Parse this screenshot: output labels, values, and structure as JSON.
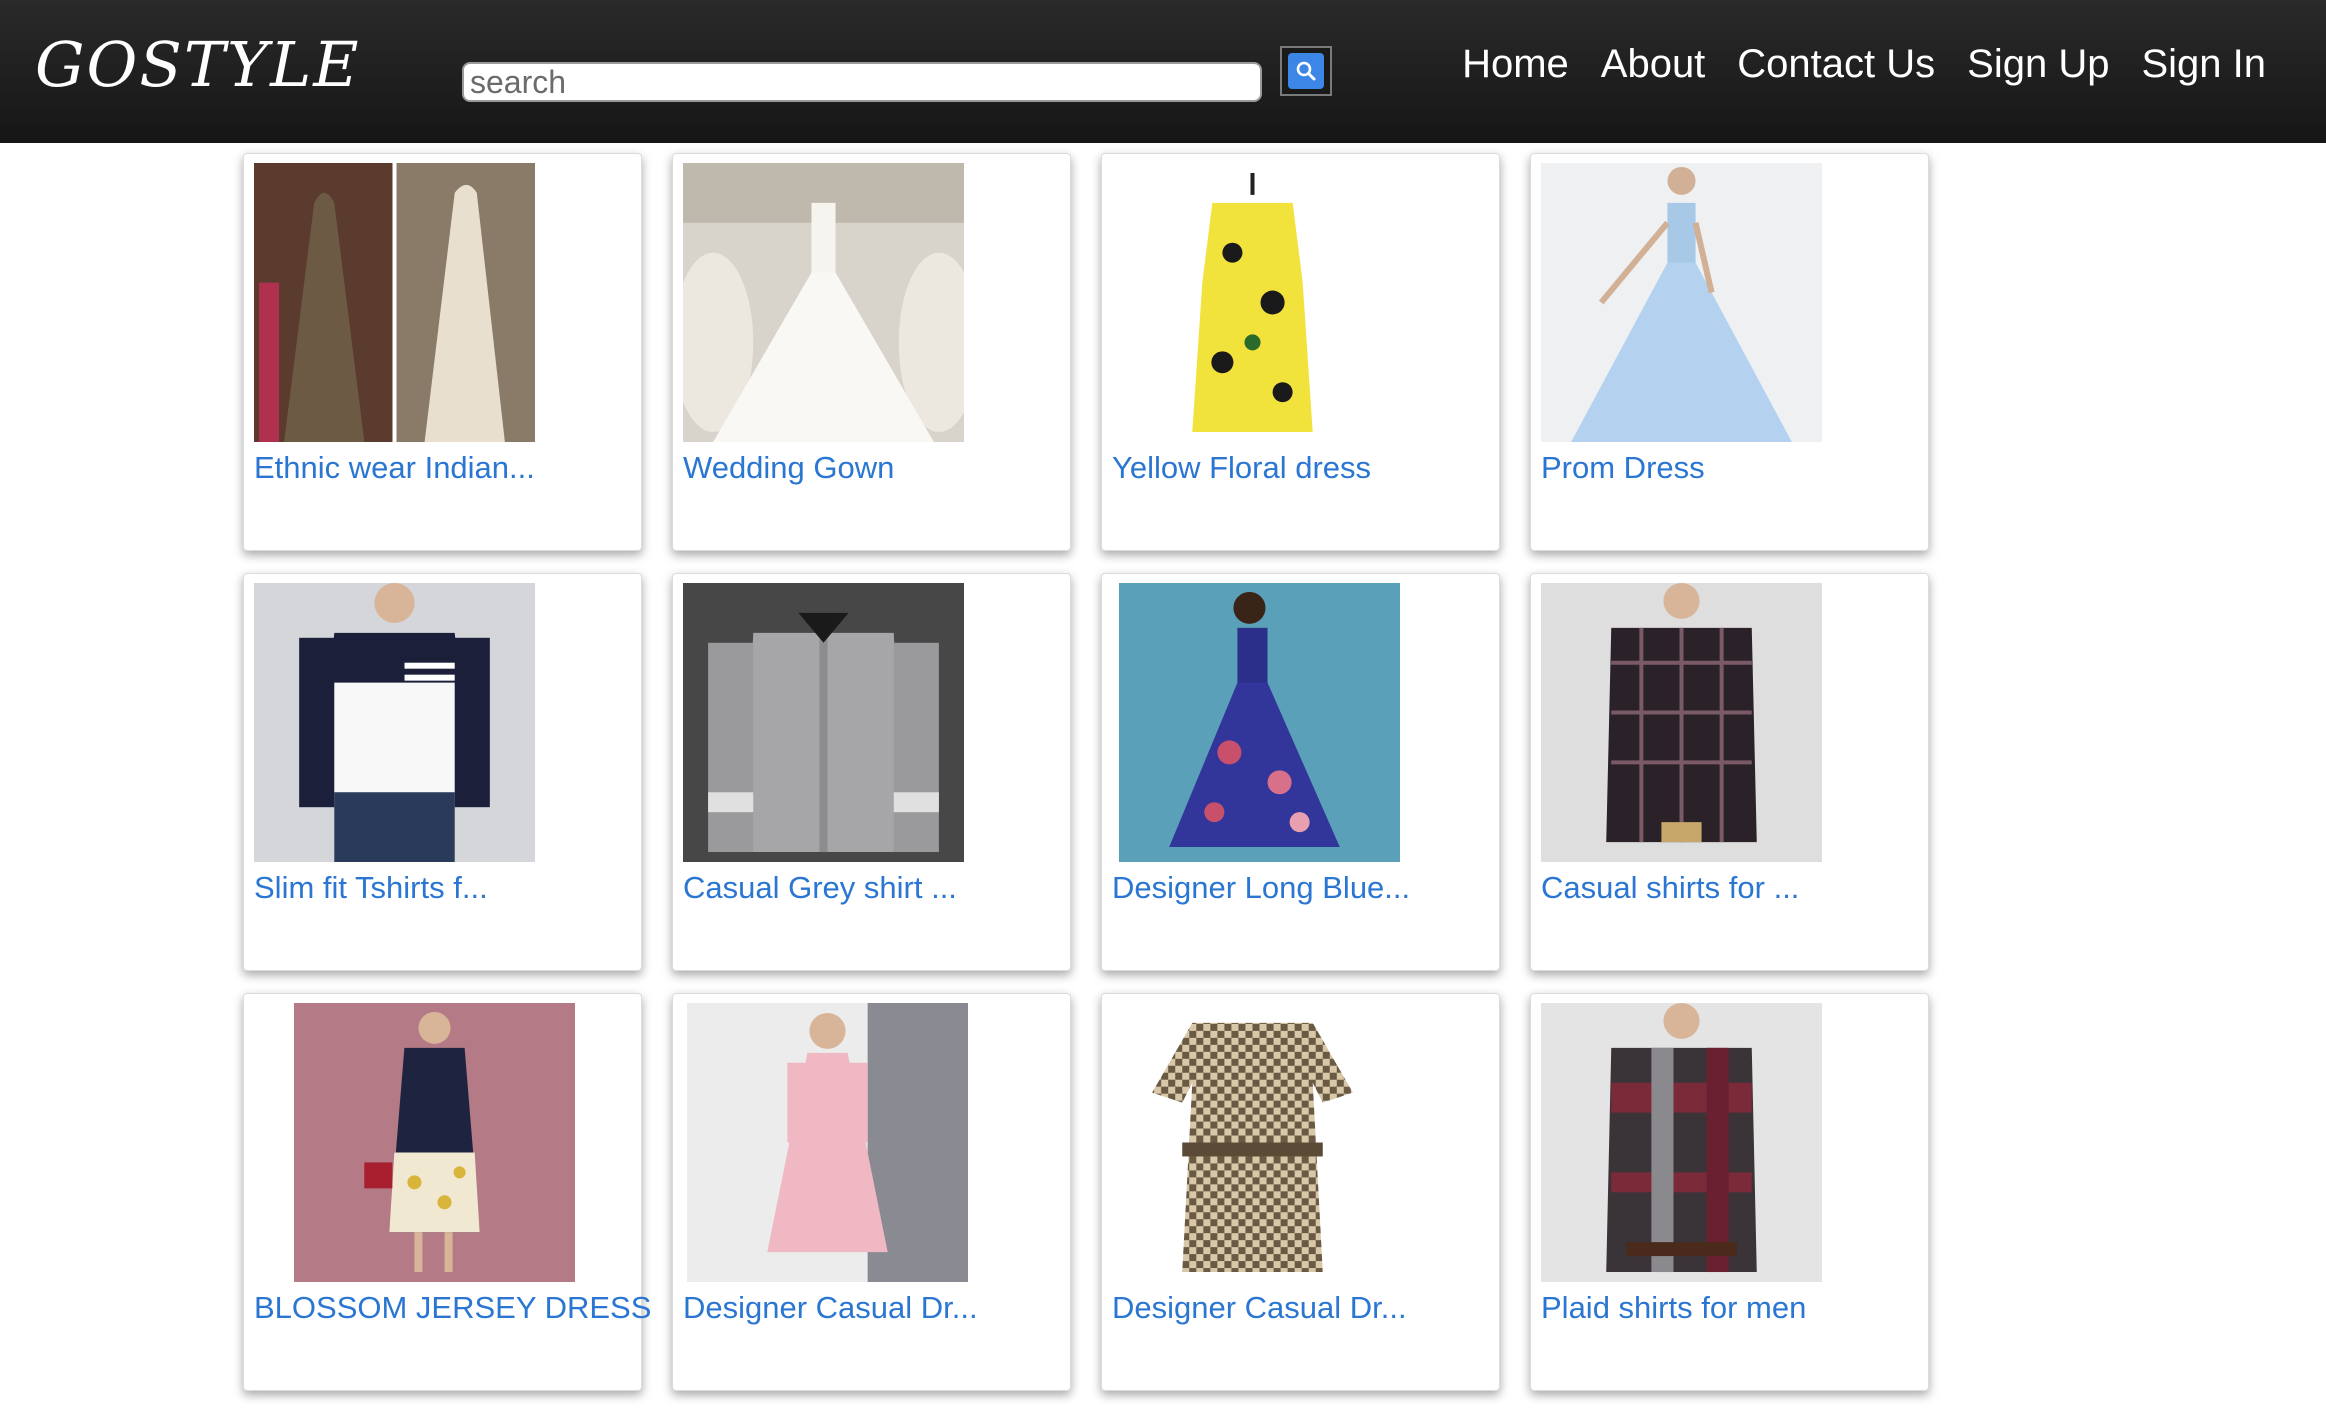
{
  "header": {
    "logo": "GOSTYLE",
    "search_placeholder": "search",
    "nav": [
      "Home",
      "About",
      "Contact Us",
      "Sign Up",
      "Sign In"
    ]
  },
  "colors": {
    "header_bg": "#1e1e1e",
    "link": "#2a76d2",
    "search_button": "#3c86e8"
  },
  "products": [
    {
      "title": "Ethnic wear Indian..."
    },
    {
      "title": "Wedding Gown"
    },
    {
      "title": "Yellow Floral dress"
    },
    {
      "title": "Prom Dress"
    },
    {
      "title": "Slim fit Tshirts f..."
    },
    {
      "title": "Casual Grey shirt ..."
    },
    {
      "title": "Designer Long Blue..."
    },
    {
      "title": "Casual shirts for ..."
    },
    {
      "title": "BLOSSOM JERSEY DRESS"
    },
    {
      "title": "Designer Casual Dr..."
    },
    {
      "title": "Designer Casual Dr..."
    },
    {
      "title": "Plaid shirts for men"
    }
  ]
}
